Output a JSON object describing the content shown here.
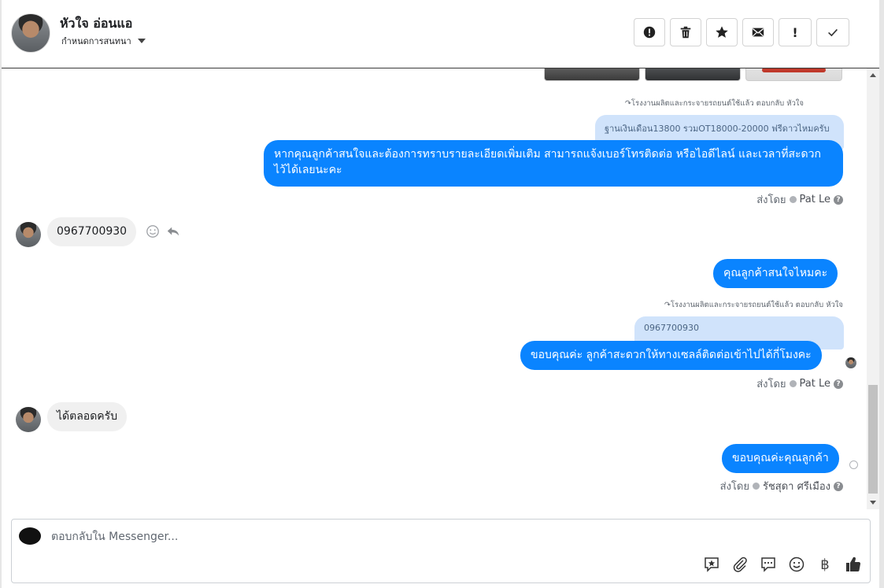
{
  "header": {
    "contact_name": "หัวใจ อ่อนแอ",
    "assign_label": "กำหนดการสนทนา",
    "toolbar": {
      "spam_icon": "exclamation-circle-icon",
      "delete_icon": "trash-icon",
      "star_icon": "star-icon",
      "unread_icon": "envelope-icon",
      "important_label": "!",
      "done_icon": "checkmark-icon"
    }
  },
  "messages": {
    "m1": {
      "reply_meta": "โรงงานผลิตและกระจายรถยนต์ใช้แล้ว ตอบกลับ หัวใจ",
      "quoted_text": "ฐานเงินเดือน13800 รวมOT18000-20000 ฟรีดาวไหมครับ",
      "text": "หากคุณลูกค้าสนใจและต้องการทราบรายละเอียดเพิ่มเติม สามารถแจ้งเบอร์โทรติดต่อ หรือไอดีไลน์ และเวลาที่สะดวก ไว้ได้เลยนะคะ",
      "sent_by_label": "ส่งโดย",
      "sent_by_name": "Pat Le"
    },
    "m2": {
      "text": "0967700930"
    },
    "m3": {
      "text": "คุณลูกค้าสนใจไหมคะ"
    },
    "m4": {
      "reply_meta": "โรงงานผลิตและกระจายรถยนต์ใช้แล้ว ตอบกลับ หัวใจ",
      "quoted_text": "0967700930",
      "text": "ขอบคุณค่ะ ลูกค้าสะดวกให้ทางเซลล์ติดต่อเข้าไปได้กี่โมงคะ",
      "sent_by_label": "ส่งโดย",
      "sent_by_name": "Pat Le"
    },
    "m5": {
      "text": "ได้ตลอดครับ"
    },
    "m6": {
      "text": "ขอบคุณค่ะคุณลูกค้า",
      "sent_by_label": "ส่งโดย",
      "sent_by_name": "รัชสุดา ศรีเมือง"
    }
  },
  "composer": {
    "placeholder": "ตอบกลับใน Messenger...",
    "baht_symbol": "฿"
  }
}
